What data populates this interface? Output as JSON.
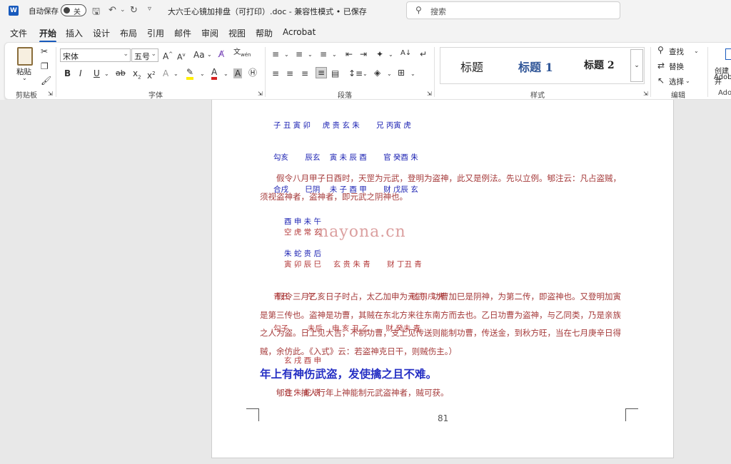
{
  "titlebar": {
    "autosave_label": "自动保存",
    "toggle_state": "关",
    "doc_title": "大六壬心镜加排盘（可打印）.doc - 兼容性模式 • 已保存",
    "search_placeholder": "搜索"
  },
  "tabs": [
    "文件",
    "开始",
    "插入",
    "设计",
    "布局",
    "引用",
    "邮件",
    "审阅",
    "视图",
    "帮助",
    "Acrobat"
  ],
  "ribbon": {
    "clipboard": {
      "paste": "粘贴",
      "group": "剪贴板"
    },
    "font": {
      "name": "宋体",
      "size": "五号",
      "group": "字体",
      "grow": "A^",
      "shrink": "A^",
      "aa": "Aa"
    },
    "paragraph": {
      "group": "段落"
    },
    "styles": {
      "group": "样式",
      "items": [
        "标题",
        "标题 1",
        "标题 2"
      ]
    },
    "editing": {
      "group": "编辑",
      "find": "查找",
      "replace": "替换",
      "select": "选择"
    },
    "adobe": {
      "create": "创建并",
      "adob": "Adob",
      "label": "Ado"
    }
  },
  "doc": {
    "diag1": [
      "子 丑 寅 卯     虎 贵 玄 朱       兄 丙寅 虎",
      "勾亥       辰玄    寅 未 辰 酉       官 癸酉 朱",
      "合戌       巳阴    未 子 酉 甲       财 戊辰 玄",
      "酉 申 未 午",
      "朱 蛇 贵 后"
    ],
    "para1": "假令八月甲子日酉时，天罡为元武，登明为盗神，此又是例法。先以立例。郇注云：凡占盗贼，须视盗神者，盗神者，即元武之阴神也。",
    "diag2": [
      "空 虎 常 玄",
      "寅 卯 辰 巳     玄 贵 朱 青       财 丁丑 青",
      "青丑        午                                        财 甲戌 朱",
      "勾子        未后    申 亥 丑 乙       财 癸未 青",
      "玄 戌 酉 申",
      "合 朱 蛇 贵"
    ],
    "watermark": "nayona.cn",
    "para2": "假令三月乙亥日子时占，太乙加申为元武，功曹加巳是阴神，为第二传，即盗神也。又登明加寅是第三传也。盗神是功曹，其贼在东北方来往东南方而去也。乙日功曹为盗神，与乙同类，乃是亲族之人为盗。日上见大吉，不制功曹，支上见传送则能制功曹，传送金，到秋方旺，当在七月庚辛日得贼，余仿此。《入式》云：若盗神克日干，则贼伤主。）",
    "heading": "年上有神伤武盗，发使擒之且不难。",
    "note": "郇注：捕人行年上神能制元武盗神者，贼可获。",
    "page_number": "81"
  },
  "colors": {
    "accent": "#185abd",
    "doc_blue": "#1d23b3",
    "doc_red": "#a53a3a",
    "heading_blue": "#2630c4"
  }
}
